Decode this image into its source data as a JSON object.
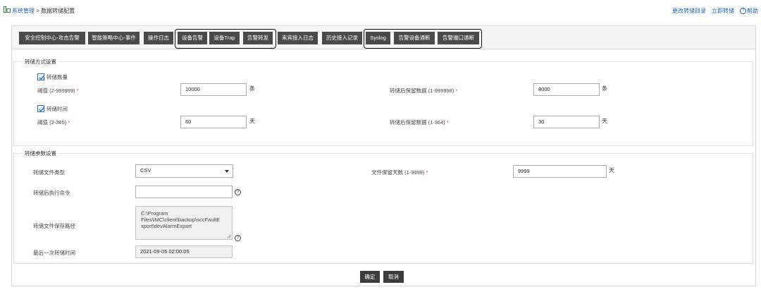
{
  "breadcrumb": {
    "root": "系统管理",
    "separator": " > ",
    "current": "数据转储配置"
  },
  "top_links": {
    "change_dir": "更改转储目录",
    "dump_now": "立即转储",
    "help": "帮助",
    "help_glyph": "?"
  },
  "tabs": [
    {
      "label": "安全控制中心-攻击告警"
    },
    {
      "label": "智能策略中心-事件"
    },
    {
      "label": "操作日志"
    },
    {
      "label": "设备告警"
    },
    {
      "label": "设备Trap"
    },
    {
      "label": "告警转发"
    },
    {
      "label": "来宾接入日志"
    },
    {
      "label": "历史接入记录"
    },
    {
      "label": "Syslog"
    },
    {
      "label": "告警设备通断"
    },
    {
      "label": "告警端口通断"
    }
  ],
  "dump_mode": {
    "legend": "转储方式设置",
    "by_count": {
      "checkbox_label": "转储数量",
      "checked": true,
      "threshold_label": "阈值 (2-999999)",
      "threshold_value": "10000",
      "threshold_unit": "条",
      "keep_label": "转储后保留数据 (1-999998)",
      "keep_value": "8000",
      "keep_unit": "条"
    },
    "by_time": {
      "checkbox_label": "转储时间",
      "checked": true,
      "threshold_label": "阈值 (2-365)",
      "threshold_value": "60",
      "threshold_unit": "天",
      "keep_label": "转储后保留数据 (1-364)",
      "keep_value": "30",
      "keep_unit": "天"
    },
    "required_mark": "*"
  },
  "dump_params": {
    "legend": "转储参数设置",
    "file_type_label": "转储文件类型",
    "file_type_value": "CSV",
    "retain_days_label": "文件保留天数 (1-9999)",
    "retain_days_value": "9999",
    "retain_days_unit": "天",
    "post_cmd_label": "转储后执行命令",
    "post_cmd_value": "",
    "help_glyph": "?",
    "path_label": "转储文件保存路径",
    "path_lines": [
      "C:\\Program",
      "Files\\iMC\\client\\backup\\sccFaultE",
      "xport\\devAlarmExport"
    ],
    "last_time_label": "最后一次转储时间",
    "last_time_value": "2021-09-05 02:00:05"
  },
  "buttons": {
    "ok": "确定",
    "cancel": "取消"
  },
  "colors": {
    "tab_bg": "#4a4a4a",
    "link": "#1a5fb4",
    "required": "#e03a3a",
    "checkbox": "#1e6fd9"
  }
}
